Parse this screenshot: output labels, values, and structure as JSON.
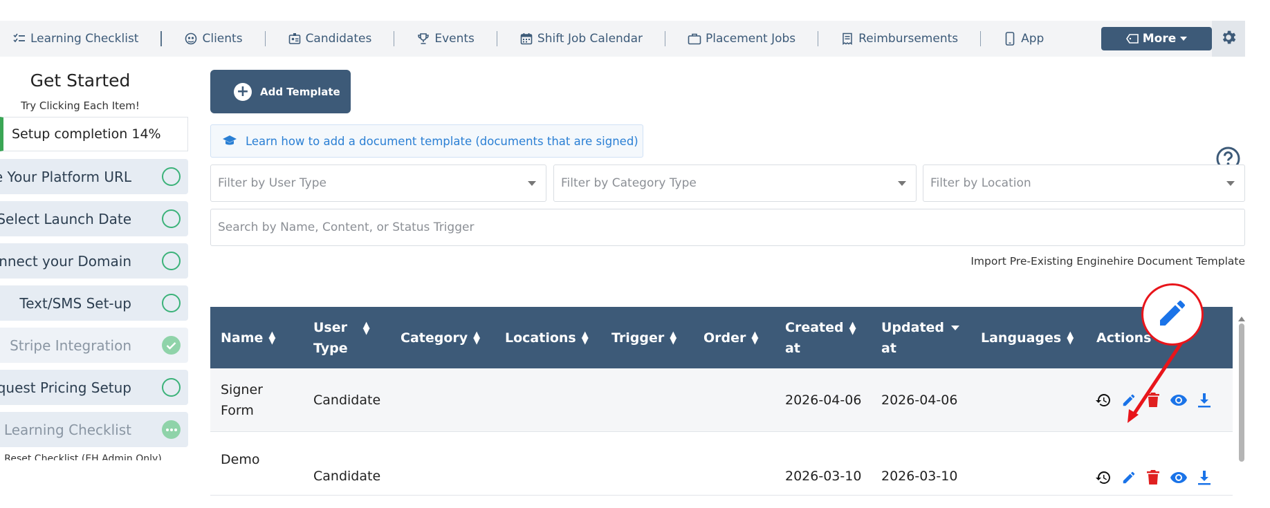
{
  "nav": {
    "items": [
      {
        "label": "Learning Checklist",
        "icon": "checklist-icon"
      },
      {
        "label": "Clients",
        "icon": "clients-icon"
      },
      {
        "label": "Candidates",
        "icon": "id-badge-icon"
      },
      {
        "label": "Events",
        "icon": "trophy-icon"
      },
      {
        "label": "Shift Job Calendar",
        "icon": "calendar-icon"
      },
      {
        "label": "Placement Jobs",
        "icon": "briefcase-icon"
      },
      {
        "label": "Reimbursements",
        "icon": "receipt-icon"
      },
      {
        "label": "App",
        "icon": "mobile-icon"
      }
    ],
    "more_label": "More",
    "settings_icon": "gear-icon"
  },
  "sidebar": {
    "title": "Get Started",
    "subtitle": "Try Clicking Each Item!",
    "completion": "Setup completion 14%",
    "items": [
      {
        "label": "Save Your Platform URL",
        "status": "open"
      },
      {
        "label": "Select Launch Date",
        "status": "open"
      },
      {
        "label": "Connect your Domain",
        "status": "open"
      },
      {
        "label": "Text/SMS Set-up",
        "status": "open"
      },
      {
        "label": "Stripe Integration",
        "status": "done"
      },
      {
        "label": "Request Pricing Setup",
        "status": "open"
      },
      {
        "label": "Start Learning Checklist",
        "status": "in-progress"
      }
    ],
    "reset": "Reset Checklist (EH Admin Only)"
  },
  "main": {
    "add_template_label": "Add Template",
    "learn_link": "Learn how to add a document template (documents that are signed)",
    "filters": {
      "user_type": "Filter by User Type",
      "category_type": "Filter by Category Type",
      "location": "Filter by Location"
    },
    "search_placeholder": "Search by Name, Content, or Status Trigger",
    "import_link": "Import Pre-Existing Enginehire Document Template"
  },
  "table": {
    "columns": {
      "name": "Name",
      "user_type_1": "User",
      "user_type_2": "Type",
      "category": "Category",
      "locations": "Locations",
      "trigger": "Trigger",
      "order": "Order",
      "created_1": "Created",
      "created_2": "at",
      "updated_1": "Updated",
      "updated_2": "at",
      "languages": "Languages",
      "actions": "Actions"
    },
    "rows": [
      {
        "name_1": "Signer",
        "name_2": "Form",
        "user_type": "Candidate",
        "category": "",
        "locations": "",
        "trigger": "",
        "order": "",
        "created_at": "2026-04-06",
        "updated_at": "2026-04-06",
        "languages": ""
      },
      {
        "name_1": "Demo",
        "name_2": "",
        "user_type": "Candidate",
        "category": "",
        "locations": "",
        "trigger": "",
        "order": "",
        "created_at": "2026-03-10",
        "updated_at": "2026-03-10",
        "languages": ""
      }
    ]
  },
  "colors": {
    "brand": "#3d5a78",
    "link": "#2a7fd4",
    "edit": "#1a73e8",
    "delete": "#e02020",
    "success": "#3bb279",
    "callout": "#e8151b"
  }
}
